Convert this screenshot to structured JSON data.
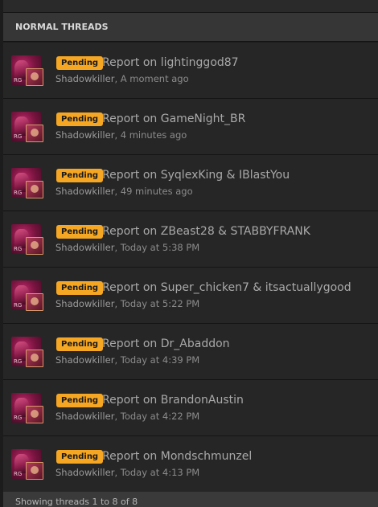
{
  "section": {
    "title": "NORMAL THREADS"
  },
  "threads": [
    {
      "status": "Pending",
      "title": "Report on lightinggod87",
      "author": "Shadowkiller",
      "time": "A moment ago"
    },
    {
      "status": "Pending",
      "title": "Report on GameNight_BR",
      "author": "Shadowkiller",
      "time": "4 minutes ago"
    },
    {
      "status": "Pending",
      "title": "Report on SyqlexKing & IBlastYou",
      "author": "Shadowkiller",
      "time": "49 minutes ago"
    },
    {
      "status": "Pending",
      "title": "Report on ZBeast28 & STABBYFRANK",
      "author": "Shadowkiller",
      "time": "Today at 5:38 PM"
    },
    {
      "status": "Pending",
      "title": "Report on Super_chicken7 & itsactuallygood",
      "author": "Shadowkiller",
      "time": "Today at 5:22 PM"
    },
    {
      "status": "Pending",
      "title": "Report on Dr_Abaddon",
      "author": "Shadowkiller",
      "time": "Today at 4:39 PM"
    },
    {
      "status": "Pending",
      "title": "Report on BrandonAustin",
      "author": "Shadowkiller",
      "time": "Today at 4:22 PM"
    },
    {
      "status": "Pending",
      "title": "Report on Mondschmunzel",
      "author": "Shadowkiller",
      "time": "Today at 4:13 PM"
    }
  ],
  "footer": {
    "text": "Showing threads 1 to 8 of 8"
  },
  "colors": {
    "pending_badge": "#f5a623",
    "row_background": "#262626",
    "header_background": "#363636"
  },
  "icons": {
    "avatar": "user-avatar",
    "avatar_badge": "secondary-avatar"
  }
}
